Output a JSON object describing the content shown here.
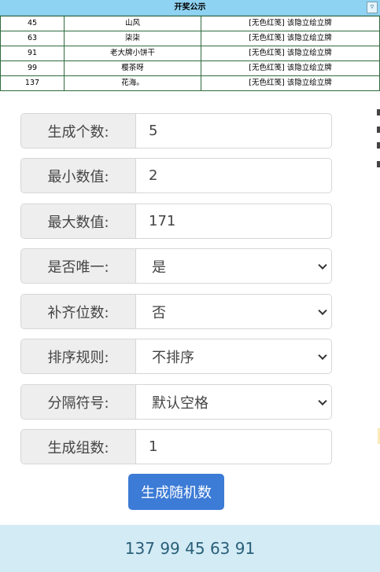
{
  "sheet": {
    "title": "开奖公示",
    "rows": [
      {
        "num": "45",
        "name": "山风",
        "note": "[无色红笺] 该隐立绘立牌"
      },
      {
        "num": "63",
        "name": "柒柒",
        "note": "[无色红笺] 该隐立绘立牌"
      },
      {
        "num": "91",
        "name": "老大牌小饼干",
        "note": "[无色红笺] 该隐立绘立牌"
      },
      {
        "num": "99",
        "name": "樱茶呀",
        "note": "[无色红笺] 该隐立绘立牌"
      },
      {
        "num": "137",
        "name": "花海。",
        "note": "[无色红笺] 该隐立绘立牌"
      }
    ]
  },
  "form": {
    "count": {
      "label": "生成个数:",
      "value": "5"
    },
    "min": {
      "label": "最小数值:",
      "value": "2"
    },
    "max": {
      "label": "最大数值:",
      "value": "171"
    },
    "unique": {
      "label": "是否唯一:",
      "value": "是"
    },
    "pad": {
      "label": "补齐位数:",
      "value": "否"
    },
    "sort": {
      "label": "排序规则:",
      "value": "不排序"
    },
    "separator": {
      "label": "分隔符号:",
      "value": "默认空格"
    },
    "groups": {
      "label": "生成组数:",
      "value": "1"
    }
  },
  "generate_button": "生成随机数",
  "result": "137 99 45 63 91",
  "colors": {
    "header": "#8fd3f2",
    "button": "#3c7bd6",
    "result_bg": "#d3ebf5",
    "result_text": "#2a5f79"
  }
}
